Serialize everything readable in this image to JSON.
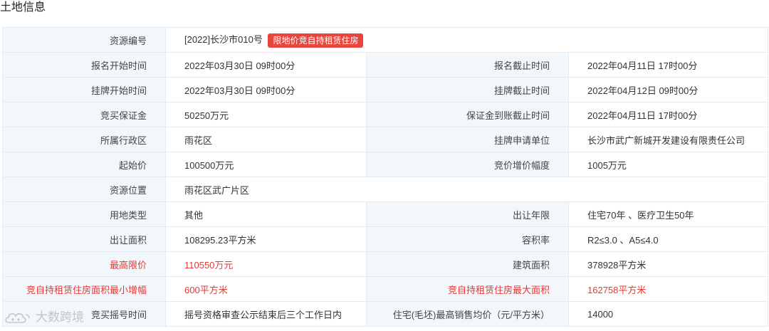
{
  "section_title": "土地信息",
  "colors": {
    "label_bg": "#f2f7fc",
    "border": "#e3ebf3",
    "highlight_red": "#e53935",
    "tag_bg": "#e8453c"
  },
  "rows": {
    "resource_id": {
      "label": "资源编号",
      "value": "[2022]长沙市010号",
      "tag": "限地价竞自持租赁住房"
    },
    "signup_start": {
      "label": "报名开始时间",
      "value": "2022年03月30日 09时00分"
    },
    "signup_end": {
      "label": "报名截止时间",
      "value": "2022年04月11日 17时00分"
    },
    "listing_start": {
      "label": "挂牌开始时间",
      "value": "2022年03月30日 09时00分"
    },
    "listing_end": {
      "label": "挂牌截止时间",
      "value": "2022年04月12日 09时00分"
    },
    "deposit": {
      "label": "竞买保证金",
      "value": "50250万元"
    },
    "deposit_deadline": {
      "label": "保证金到账截止时间",
      "value": "2022年04月11日 17时00分"
    },
    "district": {
      "label": "所属行政区",
      "value": "雨花区"
    },
    "applicant": {
      "label": "挂牌申请单位",
      "value": "长沙市武广新城开发建设有限责任公司"
    },
    "start_price": {
      "label": "起始价",
      "value": "100500万元"
    },
    "increment": {
      "label": "竞价增价幅度",
      "value": "1005万元"
    },
    "location": {
      "label": "资源位置",
      "value": "雨花区武广片区"
    },
    "land_use": {
      "label": "用地类型",
      "value": "其他"
    },
    "term": {
      "label": "出让年限",
      "value": "住宅70年 、医疗卫生50年"
    },
    "area": {
      "label": "出让面积",
      "value": "108295.23平方米"
    },
    "far": {
      "label": "容积率",
      "value": "R2≤3.0 、A5≤4.0"
    },
    "max_price": {
      "label": "最高限价",
      "value": "110550万元"
    },
    "building_area": {
      "label": "建筑面积",
      "value": "378928平方米"
    },
    "rental_min_increment": {
      "label": "竞自持租赁住房面积最小增幅",
      "value": "600平方米"
    },
    "rental_max_area": {
      "label": "竞自持租赁住房最大面积",
      "value": "162758平方米"
    },
    "lottery_time": {
      "label": "竞买摇号时间",
      "value": "摇号资格审查公示结束后三个工作日内"
    },
    "max_avg_price": {
      "label": "住宅(毛坯)最高销售均价（元/平方米）",
      "value": "14000"
    }
  },
  "watermark": {
    "text": "大数跨境",
    "icon": "cloud-logo-icon"
  }
}
